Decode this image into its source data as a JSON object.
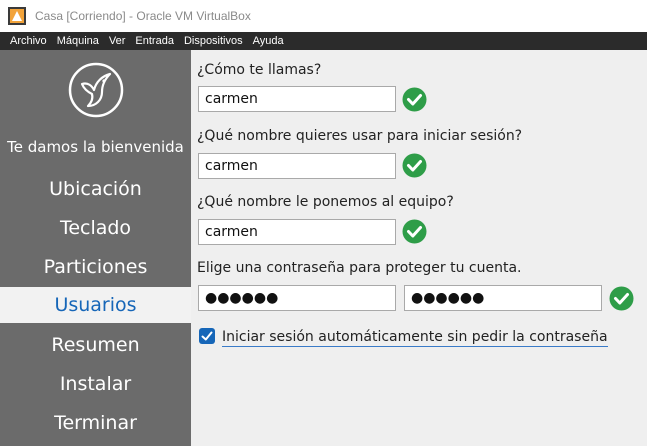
{
  "window": {
    "title": "Casa [Corriendo] - Oracle VM VirtualBox"
  },
  "menubar": {
    "items": [
      "Archivo",
      "Máquina",
      "Ver",
      "Entrada",
      "Dispositivos",
      "Ayuda"
    ]
  },
  "sidebar": {
    "welcome": "Te damos la bienvenida",
    "items": [
      "Ubicación",
      "Teclado",
      "Particiones",
      "Usuarios",
      "Resumen",
      "Instalar",
      "Terminar"
    ],
    "active": "Usuarios"
  },
  "form": {
    "name_label": "¿Cómo te llamas?",
    "name_value": "carmen",
    "login_label": "¿Qué nombre quieres usar para iniciar sesión?",
    "login_value": "carmen",
    "host_label": "¿Qué nombre le ponemos al equipo?",
    "host_value": "carmen",
    "password_label": "Elige una contraseña para proteger tu cuenta.",
    "password_value": "●●●●●●",
    "password_confirm_value": "●●●●●●",
    "autologin_label": "Iniciar sesión automáticamente sin pedir la contraseña",
    "autologin_checked": true
  },
  "colors": {
    "accent": "#1666b8",
    "valid": "#2e9d48",
    "sidebar": "#6b6b6b"
  }
}
